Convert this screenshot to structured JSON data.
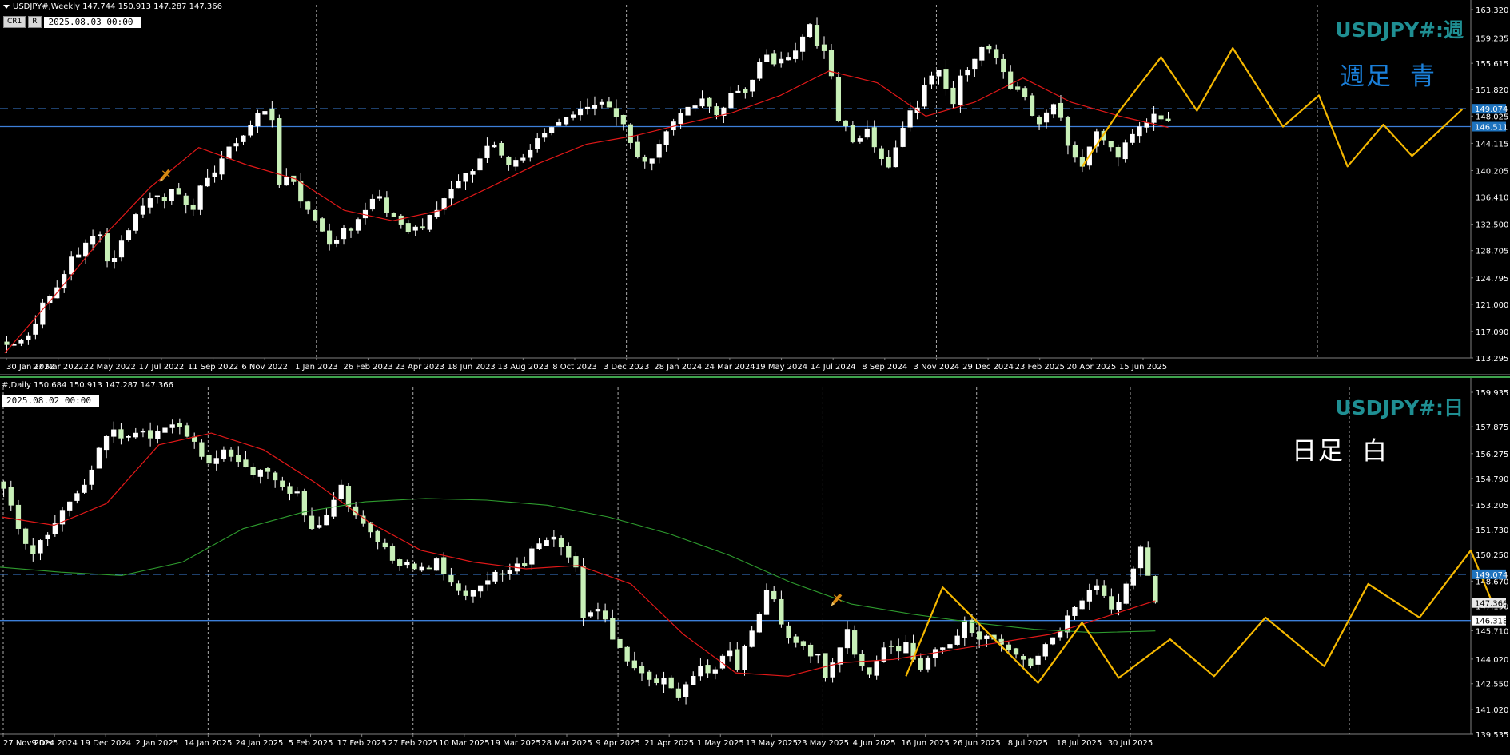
{
  "colors": {
    "background": "#000000",
    "grid": "#c8c8c8",
    "bull": "#ffffff",
    "bear": "#c8f0b8",
    "wick": "#ffffff",
    "ma_red": "#e01818",
    "ma_green": "#2e9b2e",
    "zigzag": "#f5b800",
    "hline_blue": "#3d7fd9",
    "axis_text": "#ffffff",
    "label_teal": "#1f8f93",
    "label_blue": "#1a7fd9",
    "price_tag_blue": "#1e73be"
  },
  "weekly": {
    "header": "USDJPY#,Weekly  147.744 150.913 147.287 147.366",
    "btn1": "CR1",
    "btn2": "R",
    "date_box": "2025.08.03 00:00",
    "symbol_label": "USDJPY#:週",
    "note_label_1": "週足",
    "note_label_2": "青",
    "price_tag_1": "149.074",
    "price_tag_2": "146.511",
    "icon_name": "pencil-icon"
  },
  "daily": {
    "header": "#,Daily  150.684 150.913 147.287 147.366",
    "date_box": "2025.08.02 00:00",
    "symbol_label": "USDJPY#:日",
    "note_label_1": "日足",
    "note_label_2": "白",
    "price_tag_1": "149.074",
    "price_tag_2": "147.366",
    "price_tag_3": "146.318",
    "icon_name": "pencil-icon"
  },
  "chart_data": [
    {
      "type": "candlestick",
      "timeframe": "Weekly",
      "symbol": "USDJPY#",
      "ylim": [
        113.295,
        163.32
      ],
      "y_ticks": [
        "163.320",
        "159.235",
        "155.615",
        "151.820",
        "148.025",
        "144.115",
        "140.205",
        "136.410",
        "132.500",
        "128.705",
        "124.795",
        "121.000",
        "117.090",
        "113.295"
      ],
      "x_ticks": [
        "30 Jan 2022",
        "27 Mar 2022",
        "22 May 2022",
        "17 Jul 2022",
        "11 Sep 2022",
        "6 Nov 2022",
        "1 Jan 2023",
        "26 Feb 2023",
        "23 Apr 2023",
        "18 Jun 2023",
        "13 Aug 2023",
        "8 Oct 2023",
        "3 Dec 2023",
        "28 Jan 2024",
        "24 Mar 2024",
        "19 May 2024",
        "14 Jul 2024",
        "8 Sep 2024",
        "3 Nov 2024",
        "29 Dec 2024",
        "23 Feb 2025",
        "20 Apr 2025",
        "15 Jun 2025"
      ],
      "close_path": [
        115.2,
        115.3,
        115.8,
        116.5,
        118.2,
        121.2,
        122.1,
        123.4,
        125.3,
        127.8,
        128.1,
        129.8,
        130.7,
        131.0,
        127.2,
        127.6,
        130.1,
        131.6,
        133.9,
        135.1,
        136.2,
        136.6,
        135.9,
        137.5,
        136.8,
        135.3,
        134.6,
        138.0,
        139.1,
        139.9,
        141.9,
        143.6,
        144.1,
        145.2,
        146.7,
        148.4,
        148.7,
        147.5,
        138.2,
        139.3,
        138.6,
        135.8,
        134.6,
        133.1,
        131.5,
        129.6,
        130.2,
        131.9,
        131.6,
        133.2,
        134.5,
        136.1,
        136.5,
        134.2,
        133.6,
        132.5,
        131.4,
        132.1,
        131.9,
        133.8,
        134.5,
        136.2,
        137.5,
        138.7,
        139.8,
        140.1,
        141.9,
        143.7,
        143.9,
        142.4,
        141.0,
        141.7,
        142.0,
        143.1,
        144.8,
        145.5,
        146.4,
        147.1,
        147.8,
        148.2,
        149.0,
        149.3,
        149.6,
        150.0,
        149.3,
        147.9,
        146.9,
        144.2,
        142.2,
        141.5,
        141.9,
        144.0,
        145.8,
        147.2,
        148.4,
        149.3,
        149.5,
        150.5,
        149.4,
        148.2,
        149.2,
        151.3,
        151.6,
        151.4,
        153.2,
        155.8,
        156.8,
        155.5,
        156.2,
        156.5,
        157.4,
        159.4,
        161.2,
        158.1,
        157.4,
        153.8,
        147.3,
        146.6,
        144.3,
        144.8,
        146.2,
        143.6,
        141.9,
        140.7,
        143.5,
        146.3,
        148.8,
        149.2,
        152.4,
        153.8,
        154.6,
        152.0,
        149.8,
        153.8,
        154.6,
        156.2,
        157.9,
        157.7,
        156.4,
        154.4,
        152.0,
        151.8,
        150.8,
        148.1,
        146.9,
        148.5,
        149.7,
        147.8,
        143.8,
        142.1,
        140.8,
        143.6,
        145.8,
        144.6,
        143.6,
        142.1,
        144.2,
        145.4,
        146.5,
        147.1,
        148.3,
        147.6,
        147.4
      ],
      "ma_red": [
        114.0,
        122.0,
        130.5,
        137.8,
        143.5,
        141.0,
        139.0,
        134.5,
        133.0,
        134.5,
        137.8,
        141.2,
        144.0,
        145.2,
        146.9,
        148.5,
        151.0,
        154.5,
        152.8,
        148.0,
        150.0,
        153.5,
        150.0,
        148.0,
        146.4
      ],
      "zigzag": [
        [
          150,
          140.8
        ],
        [
          155,
          148.5
        ],
        [
          161,
          156.5
        ],
        [
          166,
          148.8
        ],
        [
          171,
          157.8
        ],
        [
          178,
          146.5
        ],
        [
          183,
          151.0
        ],
        [
          187,
          140.8
        ],
        [
          192,
          146.8
        ],
        [
          196,
          142.3
        ],
        [
          203,
          149.0
        ]
      ],
      "hlines": [
        149.074,
        146.511
      ]
    },
    {
      "type": "candlestick",
      "timeframe": "Daily",
      "symbol": "USDJPY#",
      "ylim": [
        139.535,
        159.935
      ],
      "y_ticks": [
        "159.935",
        "157.875",
        "156.275",
        "154.790",
        "153.205",
        "151.730",
        "150.250",
        "148.670",
        "147.190",
        "145.710",
        "144.020",
        "142.550",
        "141.020",
        "139.535"
      ],
      "x_ticks": [
        "27 Nov 2024",
        "9 Dec 2024",
        "19 Dec 2024",
        "2 Jan 2025",
        "14 Jan 2025",
        "24 Jan 2025",
        "5 Feb 2025",
        "17 Feb 2025",
        "27 Feb 2025",
        "10 Mar 2025",
        "19 Mar 2025",
        "28 Mar 2025",
        "9 Apr 2025",
        "21 Apr 2025",
        "1 May 2025",
        "13 May 2025",
        "23 May 2025",
        "4 Jun 2025",
        "16 Jun 2025",
        "26 Jun 2025",
        "8 Jul 2025",
        "18 Jul 2025",
        "30 Jul 2025"
      ],
      "close_path": [
        154.2,
        153.2,
        151.8,
        150.9,
        150.3,
        151.1,
        151.4,
        152.1,
        152.9,
        153.4,
        153.9,
        154.4,
        155.3,
        156.6,
        157.3,
        157.7,
        157.2,
        157.3,
        157.5,
        157.6,
        157.2,
        157.6,
        157.8,
        158.0,
        157.9,
        157.3,
        157.0,
        156.1,
        155.7,
        156.0,
        156.5,
        156.1,
        155.8,
        155.5,
        155.0,
        155.3,
        155.2,
        154.7,
        154.3,
        153.9,
        154.0,
        152.6,
        151.8,
        152.0,
        152.6,
        153.5,
        154.4,
        153.1,
        152.6,
        152.1,
        151.6,
        151.0,
        150.7,
        149.9,
        149.6,
        149.8,
        149.4,
        149.5,
        149.4,
        150.0,
        149.1,
        148.6,
        148.1,
        147.8,
        148.1,
        148.4,
        148.7,
        149.2,
        149.1,
        149.3,
        149.7,
        149.6,
        150.6,
        150.9,
        151.1,
        151.3,
        150.7,
        150.1,
        149.5,
        146.5,
        146.8,
        147.0,
        146.4,
        145.2,
        144.7,
        143.9,
        143.5,
        143.2,
        142.8,
        142.6,
        142.9,
        142.3,
        141.7,
        142.5,
        143.0,
        143.6,
        143.2,
        143.4,
        144.2,
        144.5,
        143.4,
        144.8,
        145.7,
        146.7,
        148.1,
        147.6,
        146.1,
        145.3,
        145.0,
        144.8,
        144.2,
        144.3,
        142.9,
        143.8,
        144.7,
        145.8,
        144.3,
        143.6,
        143.1,
        143.9,
        144.7,
        144.8,
        144.5,
        145.0,
        144.0,
        143.4,
        144.1,
        144.6,
        144.7,
        144.9,
        145.4,
        146.3,
        145.6,
        145.2,
        145.4,
        145.2,
        144.9,
        144.6,
        144.3,
        144.0,
        143.6,
        144.2,
        144.9,
        145.3,
        145.7,
        146.6,
        147.1,
        147.5,
        148.1,
        148.4,
        147.8,
        147.0,
        147.4,
        148.5,
        149.4,
        150.7,
        149.0,
        147.4
      ],
      "ma_red": [
        152.5,
        152.0,
        153.3,
        156.8,
        157.5,
        156.5,
        154.5,
        152.2,
        150.5,
        149.8,
        149.4,
        149.6,
        148.5,
        145.5,
        143.2,
        143.0,
        143.8,
        144.0,
        144.5,
        145.0,
        145.5,
        146.5,
        147.5
      ],
      "ma_green": [
        149.5,
        149.2,
        149.0,
        149.8,
        151.8,
        152.8,
        153.4,
        153.6,
        153.5,
        153.2,
        152.5,
        151.5,
        150.2,
        148.6,
        147.3,
        146.7,
        146.2,
        145.8,
        145.6,
        145.7
      ],
      "zigzag": [
        [
          123,
          143.0
        ],
        [
          128,
          148.3
        ],
        [
          141,
          142.6
        ],
        [
          147,
          146.2
        ],
        [
          152,
          142.9
        ],
        [
          159,
          145.2
        ],
        [
          165,
          143.0
        ],
        [
          172,
          146.5
        ],
        [
          180,
          143.6
        ],
        [
          186,
          148.5
        ],
        [
          193,
          146.5
        ],
        [
          200,
          150.5
        ],
        [
          203,
          147.3
        ]
      ],
      "hlines": [
        149.074,
        146.318
      ]
    }
  ]
}
